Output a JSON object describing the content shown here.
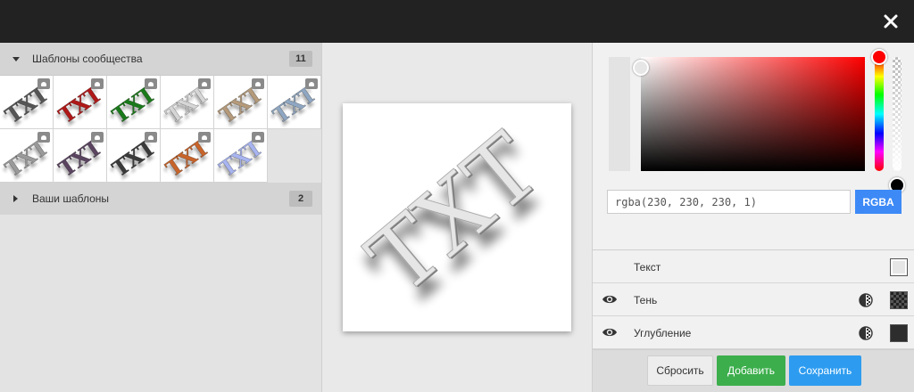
{
  "dialog": {
    "close_icon": "close-icon"
  },
  "left": {
    "community": {
      "label": "Шаблоны сообщества",
      "count": "11",
      "expanded": true
    },
    "mine": {
      "label": "Ваши шаблоны",
      "count": "2",
      "expanded": false
    },
    "templates": [
      {
        "text": "TXT",
        "color": "#555555"
      },
      {
        "text": "TXT",
        "color": "#b01818"
      },
      {
        "text": "TXT",
        "color": "#1a7a1a"
      },
      {
        "text": "TXT",
        "color": "#d6d6d6"
      },
      {
        "text": "TXT",
        "color": "#b49a7a"
      },
      {
        "text": "TXT",
        "color": "#8fa7c2"
      },
      {
        "text": "TXT",
        "color": "#9a9a9a"
      },
      {
        "text": "TXT",
        "color": "#5a4460"
      },
      {
        "text": "TXT",
        "color": "#3a3a3a"
      },
      {
        "text": "TXT",
        "color": "#c8642a"
      },
      {
        "text": "TXT",
        "color": "#a7b4f0"
      }
    ]
  },
  "preview": {
    "text": "TXT",
    "fill": "#e6e6e6"
  },
  "color_picker": {
    "value": "rgba(230, 230, 230, 1)",
    "mode": "RGBA",
    "hue_color": "#ff0000"
  },
  "layers": [
    {
      "label": "Текст",
      "visible": null,
      "swatch": "light"
    },
    {
      "label": "Тень",
      "visible": true,
      "swatch": "checker"
    },
    {
      "label": "Углубление",
      "visible": true,
      "swatch": "dark"
    }
  ],
  "buttons": {
    "reset": "Сбросить",
    "add": "Добавить",
    "save": "Сохранить"
  }
}
